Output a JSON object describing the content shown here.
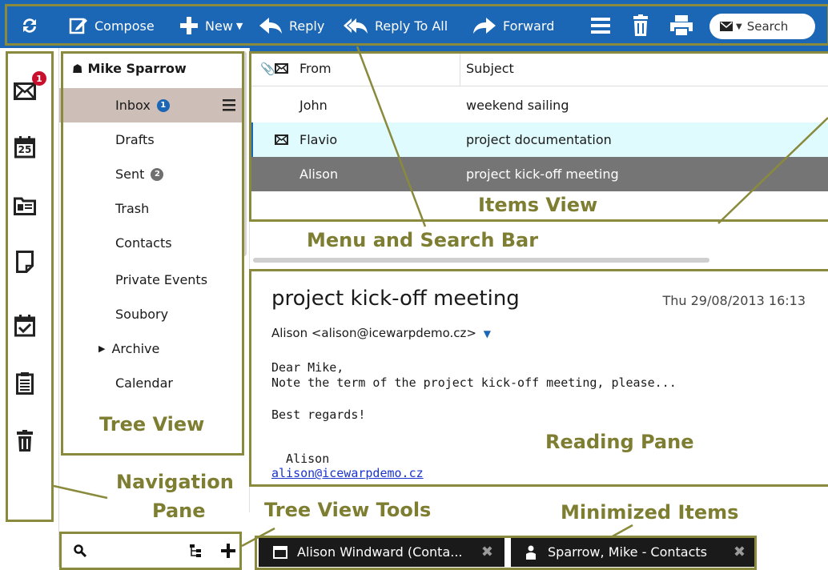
{
  "toolbar": {
    "refresh_icon": "refresh-icon",
    "compose": "Compose",
    "new": "New",
    "reply": "Reply",
    "reply_all": "Reply To All",
    "forward": "Forward",
    "search": "Search",
    "color": "#1b66b5"
  },
  "nav": {
    "mail_badge": "1",
    "calendar_day": "25",
    "icons": [
      "mail-icon",
      "calendar-icon",
      "contacts-icon",
      "notes-icon",
      "tasks-icon",
      "journal-icon",
      "trash-icon"
    ]
  },
  "tree": {
    "account": "Mike Sparrow",
    "items": [
      {
        "label": "Inbox",
        "badge": "1"
      },
      {
        "label": "Drafts"
      },
      {
        "label": "Sent",
        "badge": "2"
      },
      {
        "label": "Trash"
      },
      {
        "label": "Contacts"
      },
      {
        "label": "Private Events"
      },
      {
        "label": "Soubory"
      },
      {
        "label": "Archive"
      },
      {
        "label": "Calendar"
      }
    ]
  },
  "items_view": {
    "columns": [
      "From",
      "Subject"
    ],
    "rows": [
      {
        "from": "John",
        "subject": "weekend sailing"
      },
      {
        "from": "Flavio",
        "subject": "project documentation"
      },
      {
        "from": "Alison",
        "subject": "project kick-off meeting"
      }
    ]
  },
  "reading": {
    "subject": "project kick-off meeting",
    "date": "Thu 29/08/2013 16:13",
    "from": "Alison <alison@icewarpdemo.cz>",
    "greeting": "Dear Mike,",
    "line1": "Note the term of the project kick-off meeting, please...",
    "regards": "Best regards!",
    "signature": "  Alison",
    "email": "alison@icewarpdemo.cz"
  },
  "minimized": [
    {
      "label": "Alison Windward (Conta..."
    },
    {
      "label": "Sparrow, Mike - Contacts"
    }
  ],
  "callouts": {
    "items_view": "Items View",
    "menu_search": "Menu and Search Bar",
    "tree_view": "Tree View",
    "reading_pane": "Reading Pane",
    "navigation": "Navigation",
    "pane": "Pane",
    "tree_tools": "Tree View Tools",
    "minimized": "Minimized Items",
    "color": "#7e7e32"
  }
}
